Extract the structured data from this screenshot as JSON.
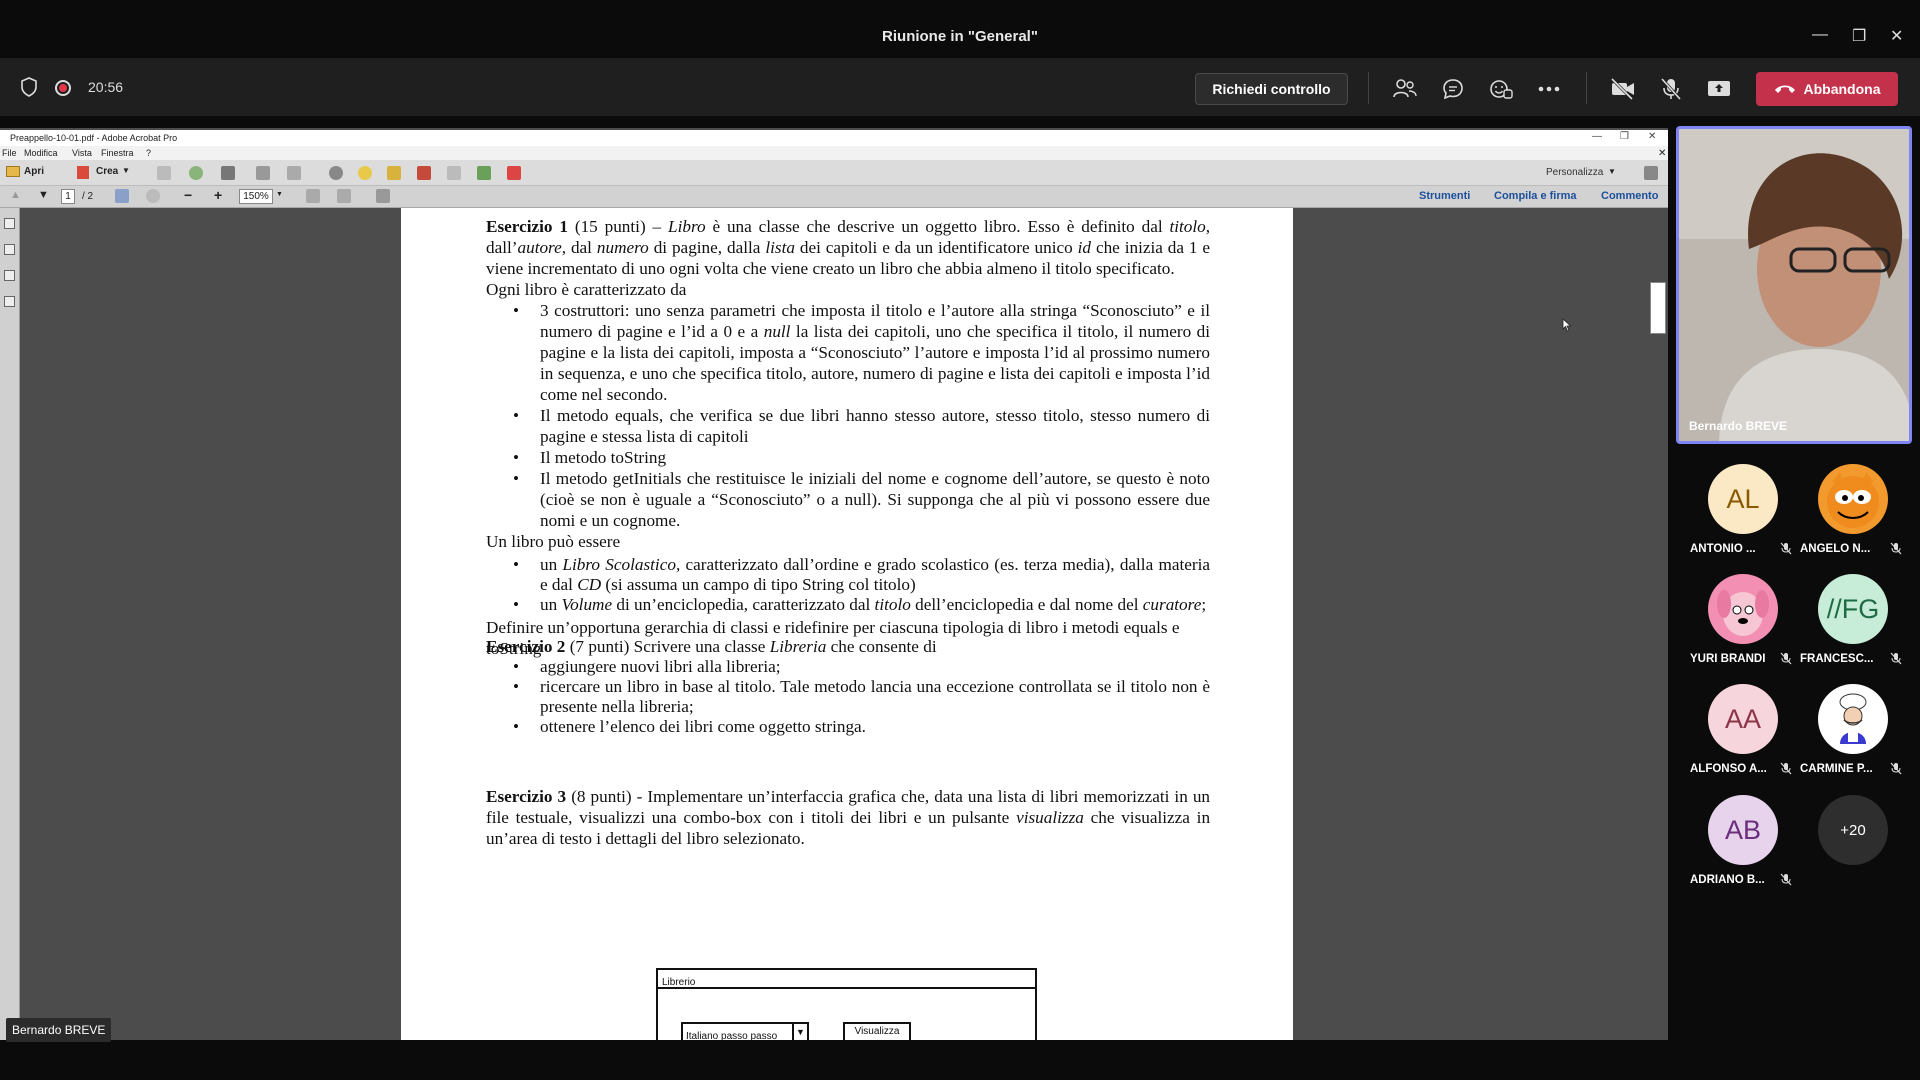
{
  "window": {
    "title": "Riunione in \"General\""
  },
  "toolbar": {
    "timer": "20:56",
    "request_control": "Richiedi controllo",
    "leave": "Abbandona"
  },
  "acrobat": {
    "title": "Preappello-10-01.pdf - Adobe Acrobat Pro",
    "menu": [
      "File",
      "Modifica",
      "Vista",
      "Finestra",
      "?"
    ],
    "open": "Apri",
    "create": "Crea",
    "customize": "Personalizza",
    "page_current": "1",
    "page_total": "/ 2",
    "zoom": "150%",
    "tools": "Strumenti",
    "fill_sign": "Compila e firma",
    "comment": "Commento"
  },
  "pdf": {
    "ex1_head": "Esercizio 1",
    "ex1_points": "(15 punti) –",
    "ex1_p1": "è una classe che descrive un oggetto libro. Esso è definito dal",
    "libro": "Libro",
    "titolo": "titolo",
    "comma_dall": ",",
    "dall": "dall’",
    "autore": "autore",
    "dal": ", dal",
    "numero": "numero",
    "di_pagine_dalla": "di pagine, dalla",
    "lista": "lista",
    "dei_capitoli": "dei capitoli e da un identificatore unico",
    "id": "id",
    "che_inizia": "che inizia da 1 e viene incrementato di uno ogni volta che viene creato un libro che abbia almeno il titolo specificato.",
    "caratterizzato": "Ogni libro è caratterizzato da",
    "b1_a": "3 costruttori: uno senza parametri che imposta il titolo e l’autore alla stringa “Sconosciuto” e il numero di pagine e l’id a 0 e a",
    "null": "null",
    "b1_b": "la lista dei capitoli,  uno che specifica il titolo, il numero di pagine e la lista dei capitoli, imposta a “Sconosciuto” l’autore e imposta l’id al prossimo numero in sequenza, e uno che specifica titolo, autore, numero di pagine e lista dei capitoli e imposta l’id come nel secondo.",
    "b2": "Il metodo equals, che verifica se due libri hanno stesso autore, stesso titolo, stesso numero di pagine e stessa lista di capitoli",
    "b3": "Il metodo toString",
    "b4": "Il metodo getInitials che restituisce le iniziali del nome e cognome dell’autore, se questo è noto (cioè se non è uguale a “Sconosciuto” o a null). Si supponga che al più vi possono essere due nomi e un cognome.",
    "puo_essere": "Un libro può essere",
    "s1_a": "un",
    "libro_scolastico": "Libro Scolastico",
    "s1_b": ", caratterizzato dall’ordine e grado scolastico (es. terza media), dalla materia e dal",
    "cd": "CD",
    "s1_c": "(si assuma un campo di tipo String col titolo)",
    "s2_a": "un",
    "volume": "Volume",
    "s2_b": "di un’enciclopedia, caratterizzato dal",
    "titolo2": "titolo",
    "s2_c": "dell’enciclopedia e dal nome del",
    "curatore": "curatore",
    "semicolon": ";",
    "definire": "Definire un’opportuna gerarchia di classi e ridefinire per ciascuna tipologia di libro i metodi equals e toString",
    "ex2_head": "Esercizio 2",
    "ex2_a": "(7 punti) Scrivere una classe",
    "libreria": "Libreria",
    "ex2_b": "che consente di",
    "e2_b1": "aggiungere nuovi libri alla libreria;",
    "e2_b2": "ricercare un libro in base al titolo. Tale metodo lancia una eccezione controllata se il titolo non è presente nella libreria;",
    "e2_b3": "ottenere l’elenco dei libri come oggetto stringa.",
    "ex3_head": "Esercizio 3",
    "ex3_a": "(8 punti) - Implementare un’interfaccia grafica che, data una lista di libri memorizzati in un file testuale, visualizzi una combo-box con i titoli dei libri e un pulsante",
    "visualizza": "visualizza",
    "ex3_b": "che visualizza in un’area di testo i dettagli del libro selezionato.",
    "diagram_title": "Librerio",
    "diagram_combo": "Italiano passo passo",
    "diagram_button": "Visualizza"
  },
  "presenter": "Bernardo BREVE",
  "video": {
    "name": "Bernardo BREVE"
  },
  "participants": [
    {
      "initials": "AL",
      "name": "ANTONIO ...",
      "bg": "#fbe9c6",
      "fg": "#8a5a00"
    },
    {
      "initials": "",
      "name": "ANGELO N...",
      "bg": "#f29a2e",
      "fg": "#000",
      "icon": "cartoon-cat-avatar"
    },
    {
      "initials": "",
      "name": "YURI BRANDI",
      "bg": "#f28fb2",
      "fg": "#000",
      "icon": "cartoon-dog-avatar"
    },
    {
      "initials": "//FG",
      "name": "FRANCESC...",
      "bg": "#c7ecd8",
      "fg": "#1e6b45"
    },
    {
      "initials": "AA",
      "name": "ALFONSO A...",
      "bg": "#f6d6dc",
      "fg": "#8c3448"
    },
    {
      "initials": "",
      "name": "CARMINE P...",
      "bg": "#ffffff",
      "fg": "#000",
      "icon": "cartoon-chef-avatar"
    },
    {
      "initials": "AB",
      "name": "ADRIANO B...",
      "bg": "#e7d3ec",
      "fg": "#6b2f7d"
    }
  ],
  "more_participants": "+20",
  "colors": {
    "leave": "#c4314b",
    "accent_border": "#7f85f5",
    "link": "#1c4f9c"
  }
}
